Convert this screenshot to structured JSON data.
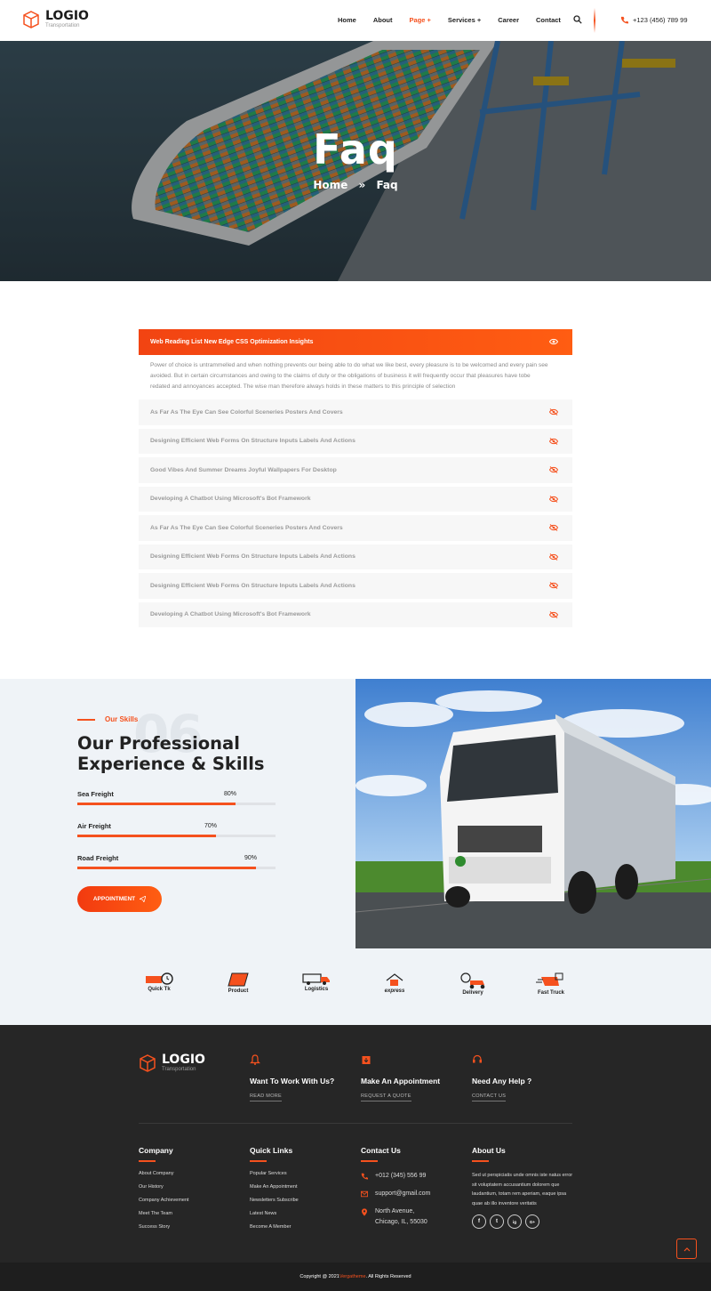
{
  "header": {
    "brand": "LOGIO",
    "brand_sub": "Transportation",
    "nav": [
      "Home",
      "About",
      "Page +",
      "Services +",
      "Career",
      "Contact"
    ],
    "phone": "+123 (456) 789 99"
  },
  "hero": {
    "title": "Faq",
    "breadcrumb_home": "Home",
    "breadcrumb_sep": "»",
    "breadcrumb_current": "Faq"
  },
  "faq": {
    "open_question": "Web Reading List New Edge CSS Optimization Insights",
    "open_answer": "Power of choice is untrammelled and when nothing prevents our being able to do what we like best, every pleasure is to be welcomed and every pain see avoided. But in certain circumstances and owing to the claims of duty or the obligations of business it will frequently occur that pleasures have tobe redated and annoyances accepted. The wise man therefore always holds in these matters to this principle of selection",
    "items": [
      "As Far As The Eye Can See Colorful Sceneries Posters And Covers",
      "Designing Efficient Web Forms On Structure Inputs Labels And Actions",
      "Good Vibes And Summer Dreams Joyful Wallpapers For Desktop",
      "Developing A Chatbot Using Microsoft's Bot Framework",
      "As Far As The Eye Can See Colorful Sceneries Posters And Covers",
      "Designing Efficient Web Forms On Structure Inputs Labels And Actions",
      "Designing Efficient Web Forms On Structure Inputs Labels And Actions",
      "Developing A Chatbot Using Microsoft's Bot Framework"
    ]
  },
  "skills": {
    "tag": "Our Skills",
    "bg_number": "06",
    "title": "Our Professional Experience & Skills",
    "bars": [
      {
        "label": "Sea Freight",
        "pct_text": "80%",
        "value": 0.8
      },
      {
        "label": "Air Freight",
        "pct_text": "70%",
        "value": 0.7
      },
      {
        "label": "Road Freight",
        "pct_text": "90%",
        "value": 0.9
      }
    ],
    "button": "APPOINTMENT"
  },
  "brands": [
    "Quick Tk",
    "Product",
    "Logistics",
    "express",
    "Delivery",
    "Fast Truck"
  ],
  "footer": {
    "brand": "LOGIO",
    "brand_sub": "Transportation",
    "ctas": [
      {
        "title": "Want To Work With Us?",
        "link": "READ MORE",
        "icon": "bell-icon"
      },
      {
        "title": "Make An Appointment",
        "link": "REQUEST A QUOTE",
        "icon": "calendar-icon"
      },
      {
        "title": "Need Any Help ?",
        "link": "CONTACT US",
        "icon": "headset-icon"
      }
    ],
    "company": {
      "heading": "Company",
      "links": [
        "About Company",
        "Our History",
        "Company Achievement",
        "Meet The Team",
        "Success Story"
      ]
    },
    "quick_links": {
      "heading": "Quick Links",
      "links": [
        "Popular Services",
        "Make An Appointment",
        "Newsletters Subscribe",
        "Latest News",
        "Become A Member"
      ]
    },
    "contact": {
      "heading": "Contact Us",
      "phone": "+012 (345) 556 99",
      "email": "support@gmail.com",
      "address_line1": "North Avenue,",
      "address_line2": "Chicago, IL, 55030"
    },
    "about": {
      "heading": "About Us",
      "text": "Sed ut perspiciatis unde omnis iste natus error sit voluptatem accusantium dolorem que laudantium, totam rem aperiam, eaque ipsa quae ab illo inventore veritatis",
      "socials": [
        "f",
        "t",
        "ig",
        "G+"
      ]
    },
    "copyright_prefix": "Copyright @ 2021 ",
    "copyright_brand": "Vergatheme",
    "copyright_suffix": ". All Rights Reserved"
  },
  "colors": {
    "accent": "#f5511e",
    "footer_bg": "#262626"
  }
}
